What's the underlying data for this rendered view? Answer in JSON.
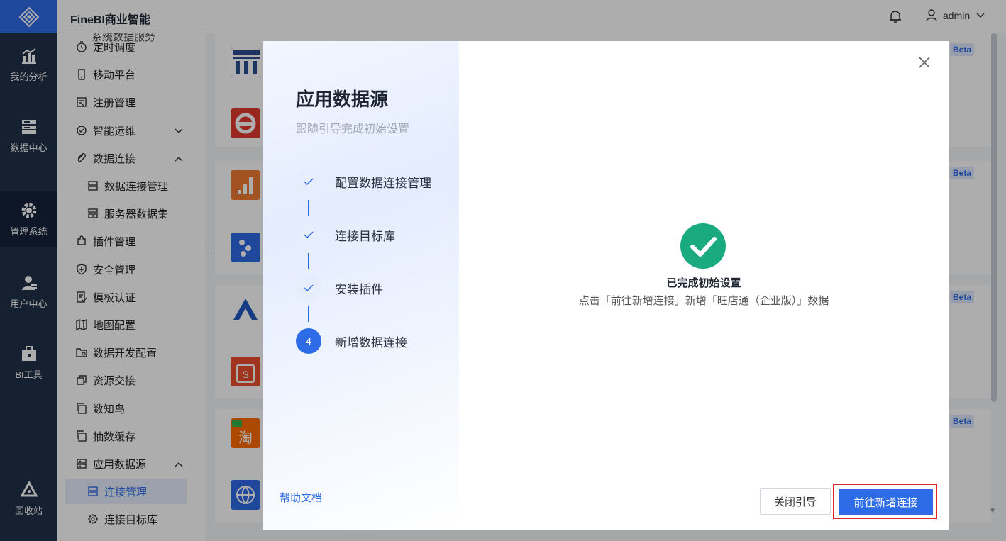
{
  "app": {
    "title": "FineBI商业智能"
  },
  "header": {
    "user": "admin"
  },
  "rail": {
    "items": [
      {
        "label": "我的分析",
        "icon": "chart-icon"
      },
      {
        "label": "数据中心",
        "icon": "database-icon"
      },
      {
        "label": "管理系统",
        "icon": "gear-icon",
        "active": true
      },
      {
        "label": "用户中心",
        "icon": "user-icon"
      },
      {
        "label": "BI工具",
        "icon": "toolbox-icon"
      },
      {
        "label": "回收站",
        "icon": "recycle-icon"
      }
    ]
  },
  "sidebar": {
    "cut_label": "系统数据服务",
    "items": [
      {
        "label": "定时调度",
        "icon": "clock-icon"
      },
      {
        "label": "移动平台",
        "icon": "mobile-icon"
      },
      {
        "label": "注册管理",
        "icon": "register-icon"
      },
      {
        "label": "智能运维",
        "icon": "ops-icon",
        "chevron": "down"
      },
      {
        "label": "数据连接",
        "icon": "link-icon",
        "chevron": "up"
      },
      {
        "label": "数据连接管理",
        "icon": "server-icon",
        "sub": true
      },
      {
        "label": "服务器数据集",
        "icon": "dataset-icon",
        "sub": true
      },
      {
        "label": "插件管理",
        "icon": "plugin-icon"
      },
      {
        "label": "安全管理",
        "icon": "shield-icon"
      },
      {
        "label": "模板认证",
        "icon": "template-icon"
      },
      {
        "label": "地图配置",
        "icon": "map-icon"
      },
      {
        "label": "数据开发配置",
        "icon": "folder-gear-icon"
      },
      {
        "label": "资源交接",
        "icon": "swap-icon"
      },
      {
        "label": "数知鸟",
        "icon": "copy-icon"
      },
      {
        "label": "抽数缓存",
        "icon": "cache-icon"
      },
      {
        "label": "应用数据源",
        "icon": "app-source-icon",
        "chevron": "up"
      },
      {
        "label": "连接管理",
        "icon": "server-icon",
        "sub": true,
        "active": true
      },
      {
        "label": "连接目标库",
        "icon": "gear-icon",
        "sub": true
      }
    ]
  },
  "background": {
    "beta_label": "Beta"
  },
  "modal": {
    "title": "应用数据源",
    "subtitle": "跟随引导完成初始设置",
    "steps": [
      {
        "label": "配置数据连接管理",
        "status": "done"
      },
      {
        "label": "连接目标库",
        "status": "done"
      },
      {
        "label": "安装插件",
        "status": "done"
      },
      {
        "label": "新增数据连接",
        "status": "current",
        "number": "4"
      }
    ],
    "help_link": "帮助文档",
    "success_title": "已完成初始设置",
    "success_desc": "点击「前往新增连接」新增「旺店通（企业版）」数据",
    "close_guide": "关闭引导",
    "primary": "前往新增连接",
    "colors": {
      "accent": "#2e6be6",
      "success": "#1aaa7f",
      "highlight": "#e02424"
    }
  }
}
